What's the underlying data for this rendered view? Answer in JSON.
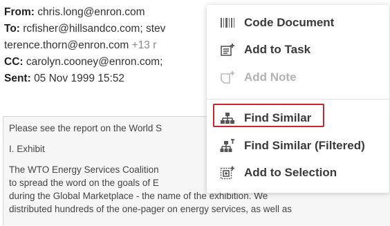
{
  "email": {
    "from_label": "From:",
    "from_value": "chris.long@enron.com",
    "to_label": "To:",
    "to_value": "rcfisher@hillsandco.com; stev",
    "to_line2": "terence.thorn@enron.com",
    "to_more": "+13 r",
    "cc_label": "CC:",
    "cc_value": "carolyn.cooney@enron.com;",
    "sent_label": "Sent:",
    "sent_value": "05 Nov 1999 15:52"
  },
  "body": {
    "line1": "Please see the report on the World S",
    "line2": "I. Exhibit",
    "line3": "The WTO Energy Services Coalition",
    "line4": "to spread the word on the goals of E",
    "line5": "during the Global Marketplace - the name of the exhibition. We",
    "line6": "distributed hundreds of the one-pager on energy services, as well as"
  },
  "menu": {
    "items": [
      {
        "label": "Code Document",
        "icon": "barcode-icon",
        "disabled": false
      },
      {
        "label": "Add to Task",
        "icon": "task-add-icon",
        "disabled": false
      },
      {
        "label": "Add Note",
        "icon": "note-add-icon",
        "disabled": true
      },
      {
        "label": "Find Similar",
        "icon": "hierarchy-icon",
        "disabled": false
      },
      {
        "label": "Find Similar (Filtered)",
        "icon": "hierarchy-filter-icon",
        "disabled": false
      },
      {
        "label": "Add to Selection",
        "icon": "selection-add-icon",
        "disabled": false
      }
    ]
  },
  "colors": {
    "highlight": "#c4262e",
    "disabled_text": "#b3b3b3"
  }
}
